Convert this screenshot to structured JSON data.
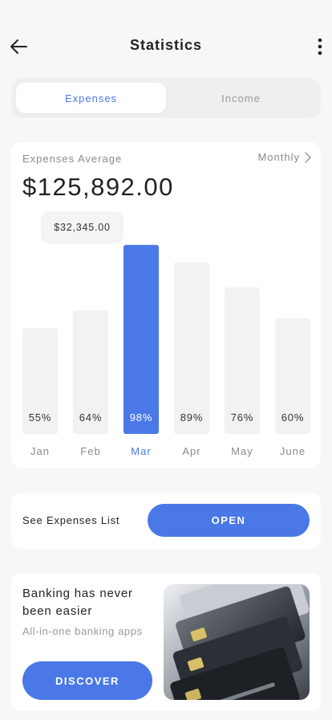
{
  "header": {
    "title": "Statistics"
  },
  "tabs": [
    {
      "label": "Expenses",
      "active": true
    },
    {
      "label": "Income",
      "active": false
    }
  ],
  "stats": {
    "average_label": "Expenses Average",
    "average_value": "$125,892.00",
    "period": "Monthly",
    "tooltip_value": "$32,345.00"
  },
  "chart_data": {
    "type": "bar",
    "categories": [
      "Jan",
      "Feb",
      "Mar",
      "Apr",
      "May",
      "June"
    ],
    "values": [
      55,
      64,
      98,
      89,
      76,
      60
    ],
    "value_labels": [
      "55%",
      "64%",
      "98%",
      "89%",
      "76%",
      "60%"
    ],
    "selected_index": 2,
    "ylim": [
      0,
      100
    ],
    "colors": {
      "bar": "#f2f2f2",
      "selected_bar": "#4a78e6",
      "label": "#333333",
      "selected_label": "#ffffff",
      "category": "#8a8a8a",
      "selected_category": "#4a78e6"
    }
  },
  "expenses_list": {
    "label": "See Expenses List",
    "button_label": "OPEN"
  },
  "promo": {
    "title": "Banking has never been easier",
    "subtitle": "All-in-one banking apps",
    "button_label": "DISCOVER",
    "image_icon": "credit-cards-image"
  },
  "colors": {
    "accent": "#4a78e6",
    "background": "#f7f7f7",
    "card": "#ffffff"
  }
}
